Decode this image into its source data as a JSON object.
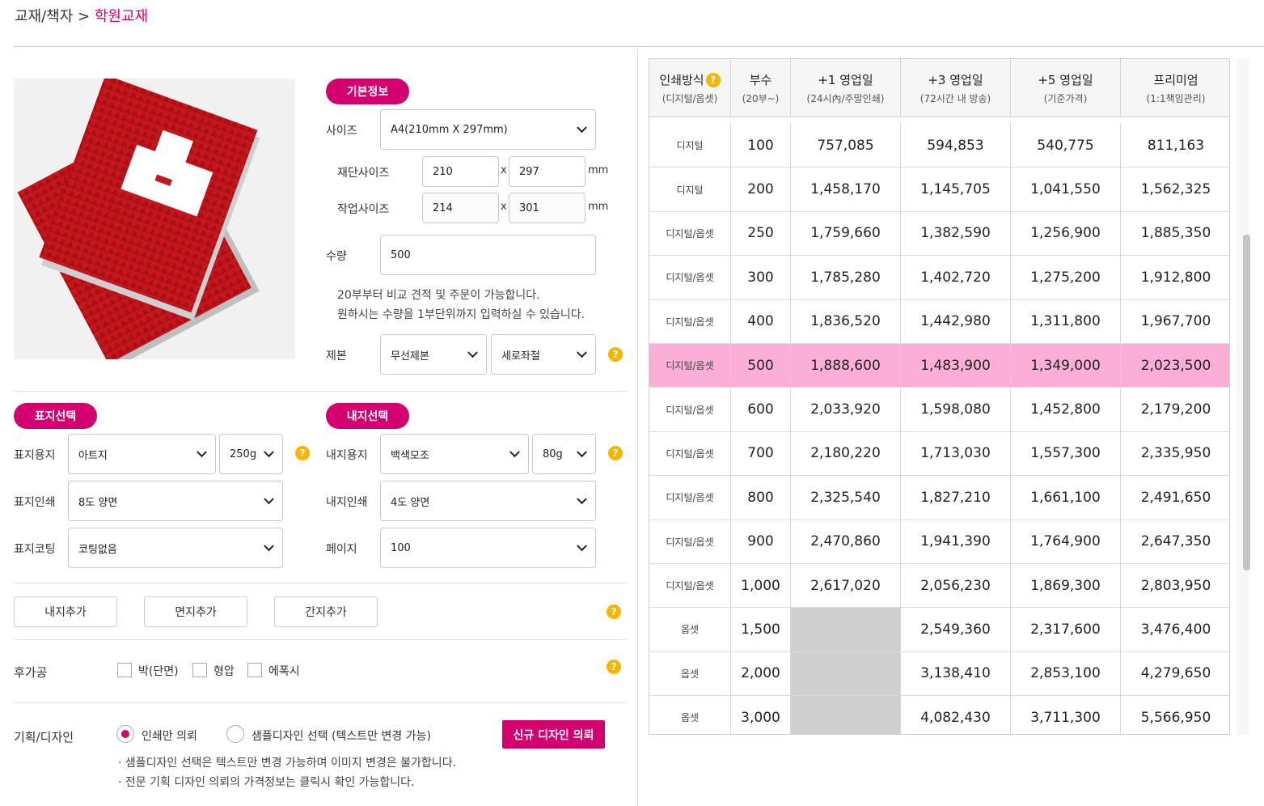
{
  "breadcrumb": {
    "parent": "교재/책자",
    "separator": ">",
    "current": "학원교재"
  },
  "basic": {
    "pill": "기본정보",
    "size_label": "사이즈",
    "size_value": "A4(210mm X 297mm)",
    "cut_label": "재단사이즈",
    "cut_w": "210",
    "cut_h": "297",
    "work_label": "작업사이즈",
    "work_w": "214",
    "work_h": "301",
    "times": "x",
    "unit": "mm",
    "qty_label": "수량",
    "qty_value": "500",
    "note1": "20부부터 비교 견적 및 주문이 가능합니다.",
    "note2": "원하시는 수량을 1부단위까지 입력하실 수 있습니다.",
    "binding_label": "제본",
    "binding_value": "무선제본",
    "binding_dir": "세로좌철"
  },
  "cover": {
    "pill": "표지선택",
    "paper_label": "표지용지",
    "paper_value": "아트지",
    "weight_value": "250g",
    "print_label": "표지인쇄",
    "print_value": "8도 양면",
    "coat_label": "표지코팅",
    "coat_value": "코팅없음"
  },
  "inner": {
    "pill": "내지선택",
    "paper_label": "내지용지",
    "paper_value": "백색모조",
    "weight_value": "80g",
    "print_label": "내지인쇄",
    "print_value": "4도 양면",
    "page_label": "페이지",
    "page_value": "100"
  },
  "add_buttons": {
    "inner": "내지추가",
    "endpaper": "면지추가",
    "tab": "간지추가"
  },
  "postprocess": {
    "label": "후가공",
    "foil": "박(단면)",
    "emboss": "형압",
    "epoxy": "에폭시"
  },
  "design": {
    "label": "기획/디자인",
    "opt1": "인쇄만 의뢰",
    "opt2": "샘플디자인 선택 (텍스트만 변경 가능)",
    "new_button": "신규 디자인 의뢰",
    "note1": "· 샘플디자인 선택은 텍스트만 변경 가능하며 이미지 변경은 불가합니다.",
    "note2": "· 전문 기획 디자인 의뢰의 가격정보는 클릭시 확인 가능합니다."
  },
  "help_glyph": "?",
  "icons": {
    "help": "help-icon",
    "dropdown": "chevron-down-icon"
  },
  "colors": {
    "accent": "#d4006f",
    "help": "#f7b500",
    "selected_row": "#fbaed6",
    "unavailable": "#cfcfcf"
  },
  "table": {
    "headers": [
      {
        "title": "인쇄방식",
        "sub": "(디지털/옵셋)"
      },
      {
        "title": "부수",
        "sub": "(20부~)"
      },
      {
        "title": "+1 영업일",
        "sub": "(24시內/주말인쇄)"
      },
      {
        "title": "+3 영업일",
        "sub": "(72시간 내 방송)"
      },
      {
        "title": "+5 영업일",
        "sub": "(기준가격)"
      },
      {
        "title": "프리미엄",
        "sub": "(1:1책임관리)"
      }
    ],
    "selected_qty": "500",
    "rows": [
      {
        "method": "디지털",
        "qty": "100",
        "d1": "757,085",
        "d3": "594,853",
        "d5": "540,775",
        "premium": "811,163"
      },
      {
        "method": "디지털",
        "qty": "200",
        "d1": "1,458,170",
        "d3": "1,145,705",
        "d5": "1,041,550",
        "premium": "1,562,325"
      },
      {
        "method": "디지털/옵셋",
        "qty": "250",
        "d1": "1,759,660",
        "d3": "1,382,590",
        "d5": "1,256,900",
        "premium": "1,885,350"
      },
      {
        "method": "디지털/옵셋",
        "qty": "300",
        "d1": "1,785,280",
        "d3": "1,402,720",
        "d5": "1,275,200",
        "premium": "1,912,800"
      },
      {
        "method": "디지털/옵셋",
        "qty": "400",
        "d1": "1,836,520",
        "d3": "1,442,980",
        "d5": "1,311,800",
        "premium": "1,967,700"
      },
      {
        "method": "디지털/옵셋",
        "qty": "500",
        "d1": "1,888,600",
        "d3": "1,483,900",
        "d5": "1,349,000",
        "premium": "2,023,500"
      },
      {
        "method": "디지털/옵셋",
        "qty": "600",
        "d1": "2,033,920",
        "d3": "1,598,080",
        "d5": "1,452,800",
        "premium": "2,179,200"
      },
      {
        "method": "디지털/옵셋",
        "qty": "700",
        "d1": "2,180,220",
        "d3": "1,713,030",
        "d5": "1,557,300",
        "premium": "2,335,950"
      },
      {
        "method": "디지털/옵셋",
        "qty": "800",
        "d1": "2,325,540",
        "d3": "1,827,210",
        "d5": "1,661,100",
        "premium": "2,491,650"
      },
      {
        "method": "디지털/옵셋",
        "qty": "900",
        "d1": "2,470,860",
        "d3": "1,941,390",
        "d5": "1,764,900",
        "premium": "2,647,350"
      },
      {
        "method": "디지털/옵셋",
        "qty": "1,000",
        "d1": "2,617,020",
        "d3": "2,056,230",
        "d5": "1,869,300",
        "premium": "2,803,950"
      },
      {
        "method": "옵셋",
        "qty": "1,500",
        "d1": "",
        "d3": "2,549,360",
        "d5": "2,317,600",
        "premium": "3,476,400"
      },
      {
        "method": "옵셋",
        "qty": "2,000",
        "d1": "",
        "d3": "3,138,410",
        "d5": "2,853,100",
        "premium": "4,279,650"
      },
      {
        "method": "옵셋",
        "qty": "3,000",
        "d1": "",
        "d3": "4,082,430",
        "d5": "3,711,300",
        "premium": "5,566,950"
      }
    ]
  }
}
